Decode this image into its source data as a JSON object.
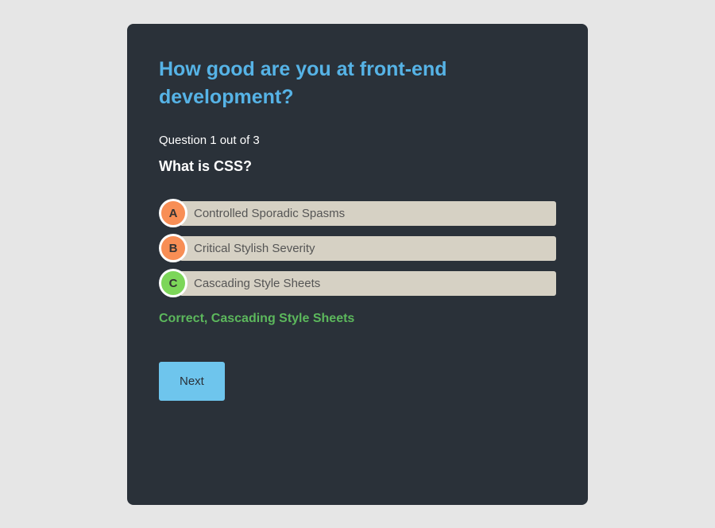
{
  "title": "How good are you at front-end development?",
  "progress": "Question 1 out of 3",
  "question": "What is CSS?",
  "options": [
    {
      "letter": "A",
      "text": "Controlled Sporadic Spasms",
      "color": "orange"
    },
    {
      "letter": "B",
      "text": "Critical Stylish Severity",
      "color": "orange"
    },
    {
      "letter": "C",
      "text": "Cascading Style Sheets",
      "color": "green"
    }
  ],
  "feedback": "Correct, Cascading Style Sheets",
  "nextLabel": "Next"
}
